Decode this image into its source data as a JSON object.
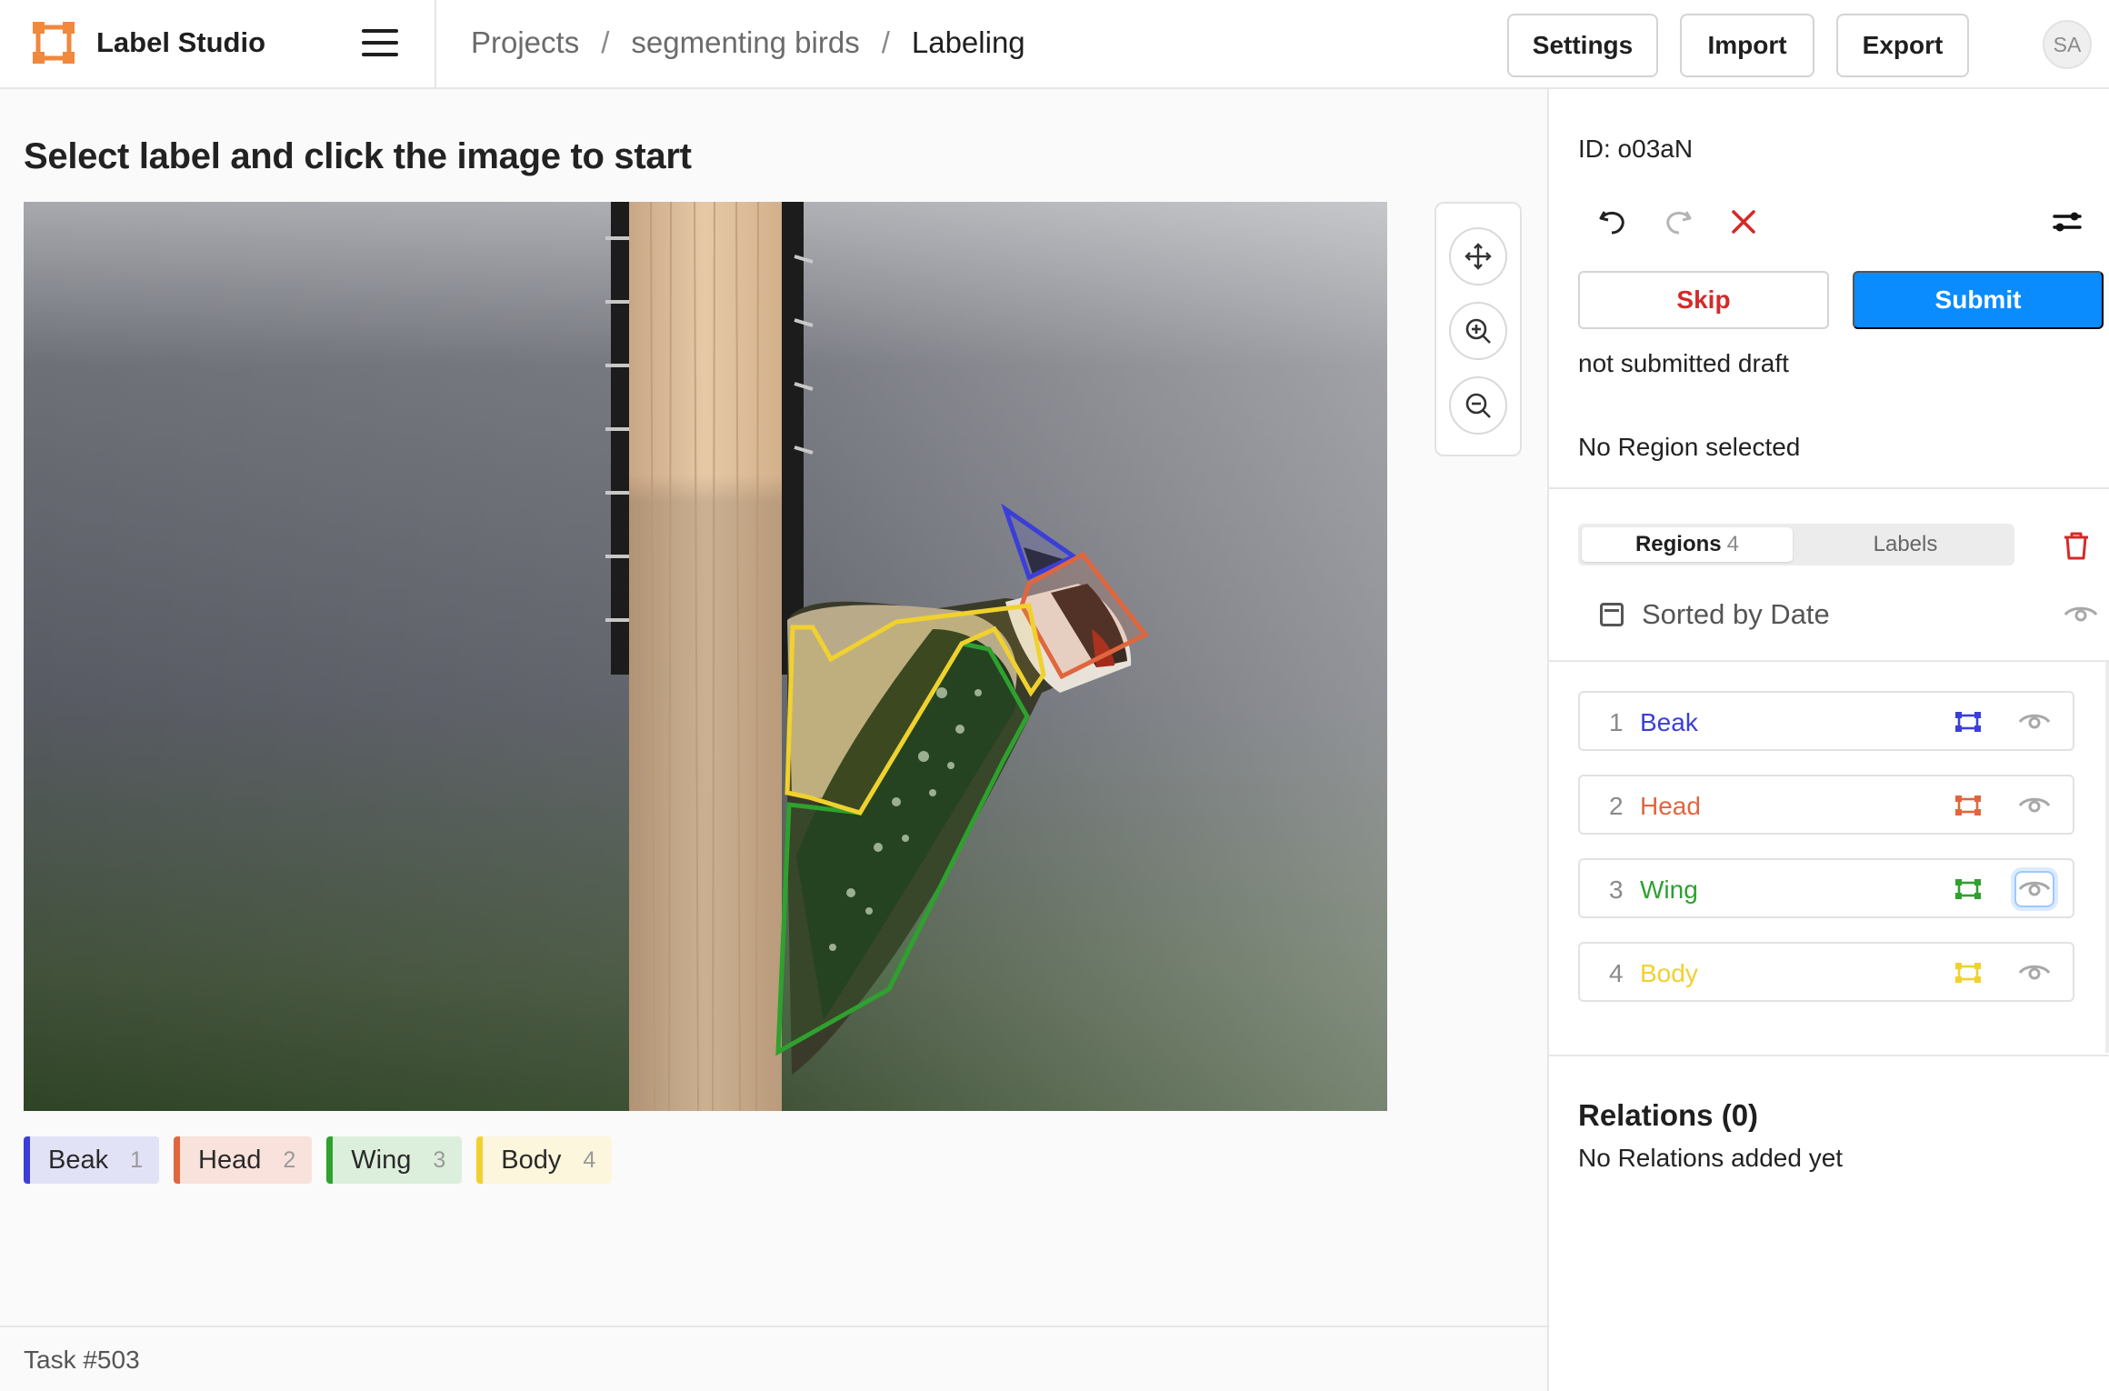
{
  "app": {
    "name": "Label Studio"
  },
  "breadcrumb": {
    "projects": "Projects",
    "project": "segmenting birds",
    "current": "Labeling",
    "sep": "/"
  },
  "header": {
    "settings": "Settings",
    "import": "Import",
    "export": "Export",
    "avatar": "SA"
  },
  "main": {
    "instruction": "Select label and click the image to start",
    "task": "Task #503"
  },
  "labels": [
    {
      "name": "Beak",
      "hotkey": "1",
      "color": "#3b3fd8",
      "bg": "#e2e2f7"
    },
    {
      "name": "Head",
      "hotkey": "2",
      "color": "#e0663e",
      "bg": "#f9e2db"
    },
    {
      "name": "Wing",
      "hotkey": "3",
      "color": "#2ea12e",
      "bg": "#dcefdc"
    },
    {
      "name": "Body",
      "hotkey": "4",
      "color": "#f0d12e",
      "bg": "#fbf6dc"
    }
  ],
  "sidebar": {
    "annotation_id": "ID: o03aN",
    "skip": "Skip",
    "submit": "Submit",
    "draft": "not submitted draft",
    "no_region": "No Region selected",
    "tab_regions": "Regions",
    "tab_regions_count": "4",
    "tab_labels": "Labels",
    "sorted": "Sorted by Date",
    "regions": [
      {
        "num": "1",
        "name": "Beak",
        "color": "#3b3fd8"
      },
      {
        "num": "2",
        "name": "Head",
        "color": "#e0663e"
      },
      {
        "num": "3",
        "name": "Wing",
        "color": "#2ea12e"
      },
      {
        "num": "4",
        "name": "Body",
        "color": "#f0d12e"
      }
    ],
    "relations_title": "Relations (0)",
    "relations_empty": "No Relations added yet"
  },
  "colors": {
    "accent": "#0a8cff",
    "danger": "#d42a2a",
    "logo": "#f0883e"
  }
}
